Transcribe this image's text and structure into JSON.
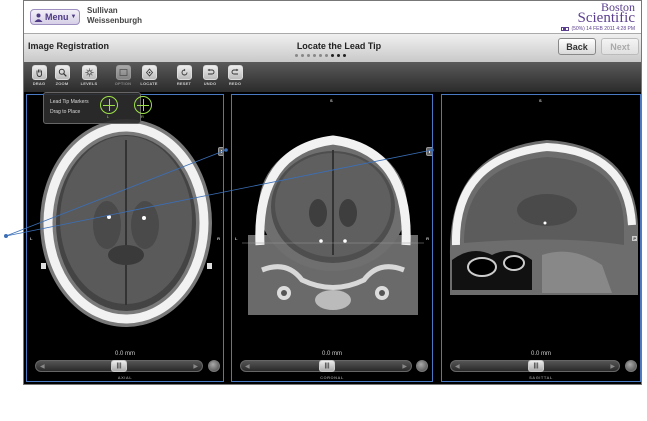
{
  "header": {
    "menu_label": "Menu",
    "patient_first": "Sullivan",
    "patient_last": "Weissenburgh",
    "brand_line1": "Boston",
    "brand_line2": "Scientific",
    "status_text": "(50%) 14 FEB 2011 4:28 PM"
  },
  "titlebar": {
    "page_title": "Image Registration",
    "step_title": "Locate the Lead Tip",
    "back_label": "Back",
    "next_label": "Next",
    "step_dots": {
      "total": 9,
      "current": 7
    }
  },
  "toolbar": {
    "tools": [
      {
        "label": "DRAG",
        "icon": "hand-icon"
      },
      {
        "label": "ZOOM",
        "icon": "magnifier-icon"
      },
      {
        "label": "LEVELS",
        "icon": "sun-icon"
      },
      {
        "label": "OPTION",
        "icon": "image-icon"
      },
      {
        "label": "LOCATE",
        "icon": "locate-icon"
      },
      {
        "label": "RESET",
        "icon": "reset-icon"
      },
      {
        "label": "UNDO",
        "icon": "undo-icon"
      },
      {
        "label": "REDO",
        "icon": "redo-icon"
      }
    ]
  },
  "tooltip": {
    "line1": "Lead Tip Markers",
    "line2": "Drag to Place",
    "marker_left": "L",
    "marker_right": "R"
  },
  "views": [
    {
      "name": "AXIAL",
      "distance": "0.0 mm",
      "top": "",
      "left": "L",
      "right": "R"
    },
    {
      "name": "CORONAL",
      "distance": "0.0 mm",
      "top": "S",
      "left": "L",
      "right": "R"
    },
    {
      "name": "SAGITTAL",
      "distance": "0.0 mm",
      "top": "S",
      "left": "",
      "right": "P"
    }
  ],
  "colors": {
    "brand": "#5b3f8e",
    "view_border": "#4a79c4",
    "marker": "#9ee04a",
    "annotation_line": "#3a6fb8"
  }
}
